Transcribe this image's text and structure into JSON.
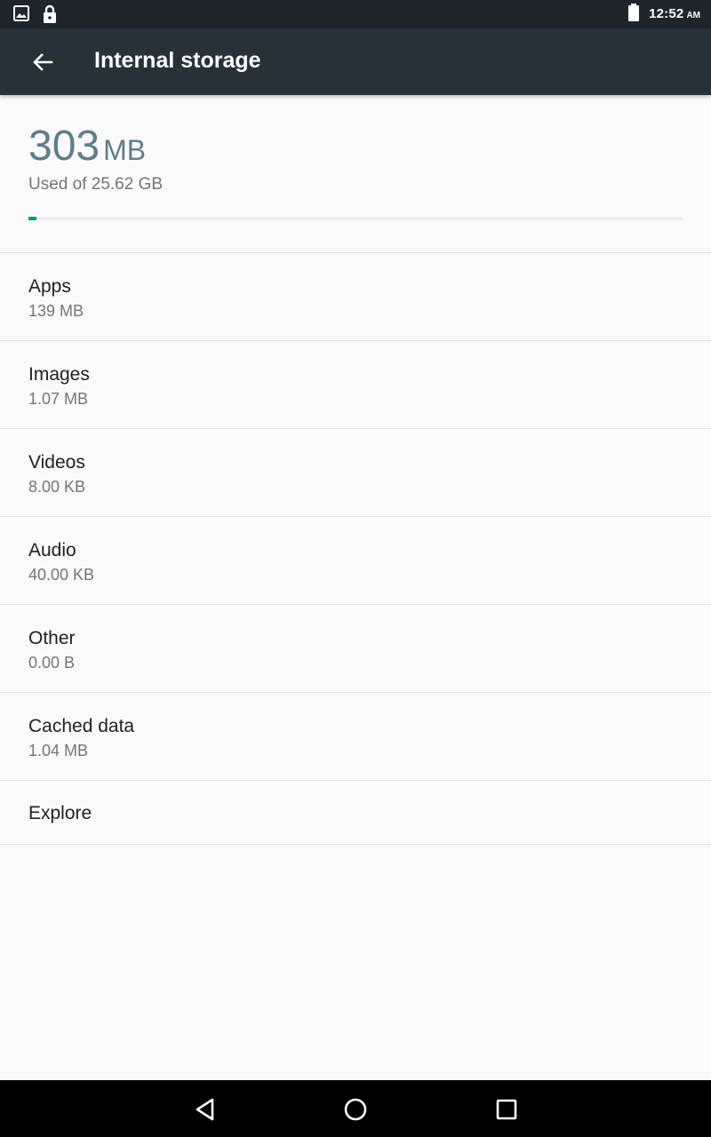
{
  "status_bar": {
    "time": "12:52",
    "time_suffix": "AM",
    "icons": [
      "image-notification-icon",
      "lock-icon",
      "battery-icon"
    ]
  },
  "app_bar": {
    "title": "Internal storage",
    "back_icon": "arrow-back-icon"
  },
  "storage": {
    "used_value": "303",
    "used_unit": "MB",
    "caption": "Used of 25.62 GB",
    "progress_fraction": 0.012,
    "accent_color": "#009688"
  },
  "items": [
    {
      "title": "Apps",
      "size": "139 MB"
    },
    {
      "title": "Images",
      "size": "1.07 MB"
    },
    {
      "title": "Videos",
      "size": "8.00 KB"
    },
    {
      "title": "Audio",
      "size": "40.00 KB"
    },
    {
      "title": "Other",
      "size": "0.00 B"
    },
    {
      "title": "Cached data",
      "size": "1.04 MB"
    }
  ],
  "explore": {
    "title": "Explore"
  },
  "nav_bar": {
    "icons": [
      "nav-back-icon",
      "nav-home-icon",
      "nav-recents-icon"
    ]
  }
}
